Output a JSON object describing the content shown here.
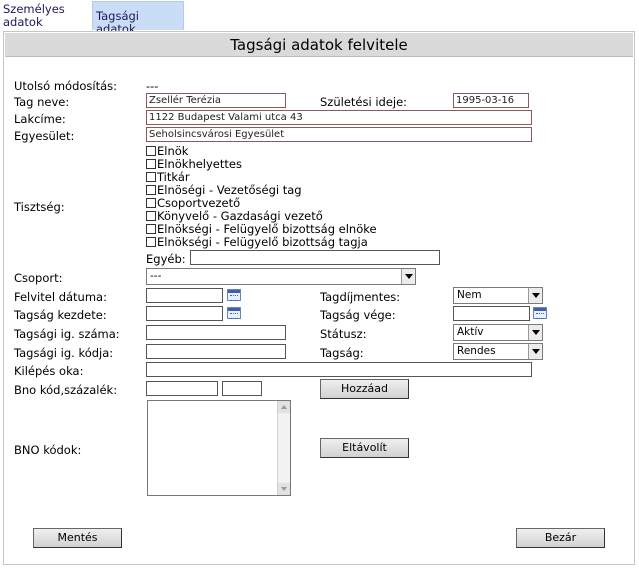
{
  "tabs": {
    "personal": "Személyes adatok",
    "membership": "Tagsági adatok"
  },
  "title": "Tagsági adatok felvitele",
  "labels": {
    "last_modified": "Utolsó módosítás:",
    "member_name": "Tag neve:",
    "birth_date": "Születési ideje:",
    "address": "Lakcíme:",
    "association": "Egyesület:",
    "position": "Tisztség:",
    "other": "Egyéb:",
    "group": "Csoport:",
    "entry_date": "Felvitel dátuma:",
    "fee_exempt": "Tagdíjmentes:",
    "membership_start": "Tagság kezdete:",
    "membership_end": "Tagság vége:",
    "card_number": "Tagsági ig. száma:",
    "status": "Státusz:",
    "card_code": "Tagsági ig. kódja:",
    "membership_type": "Tagság:",
    "exit_reason": "Kilépés oka:",
    "bno_code_percent": "Bno kód,százalék:",
    "bno_codes": "BNO kódok:"
  },
  "values": {
    "last_modified": "---",
    "member_name": "Zsellér Terézia",
    "birth_date": "1995-03-16",
    "address": "1122 Budapest Valami utca 43",
    "association": "Seholsincsvárosi Egyesület",
    "other": "",
    "group": "---",
    "entry_date": "",
    "fee_exempt": "Nem",
    "membership_start": "",
    "membership_end": "",
    "card_number": "",
    "status": "Aktív",
    "card_code": "",
    "membership_type": "Rendes",
    "exit_reason": "",
    "bno_code": "",
    "bno_percent": ""
  },
  "positions": [
    "Elnök",
    "Elnökhelyettes",
    "Titkár",
    "Elnöségi - Vezetőségi tag",
    "Csoportvezető",
    "Könyvelő - Gazdasági vezető",
    "Elnökségi - Felügyelő bizottság elnöke",
    "Elnökségi - Felügyelő bizottság tagja"
  ],
  "buttons": {
    "add": "Hozzáad",
    "remove": "Eltávolít",
    "save": "Mentés",
    "close": "Bezár"
  },
  "icons": {
    "calendar": "calendar-icon",
    "dropdown": "chevron-down-icon"
  }
}
